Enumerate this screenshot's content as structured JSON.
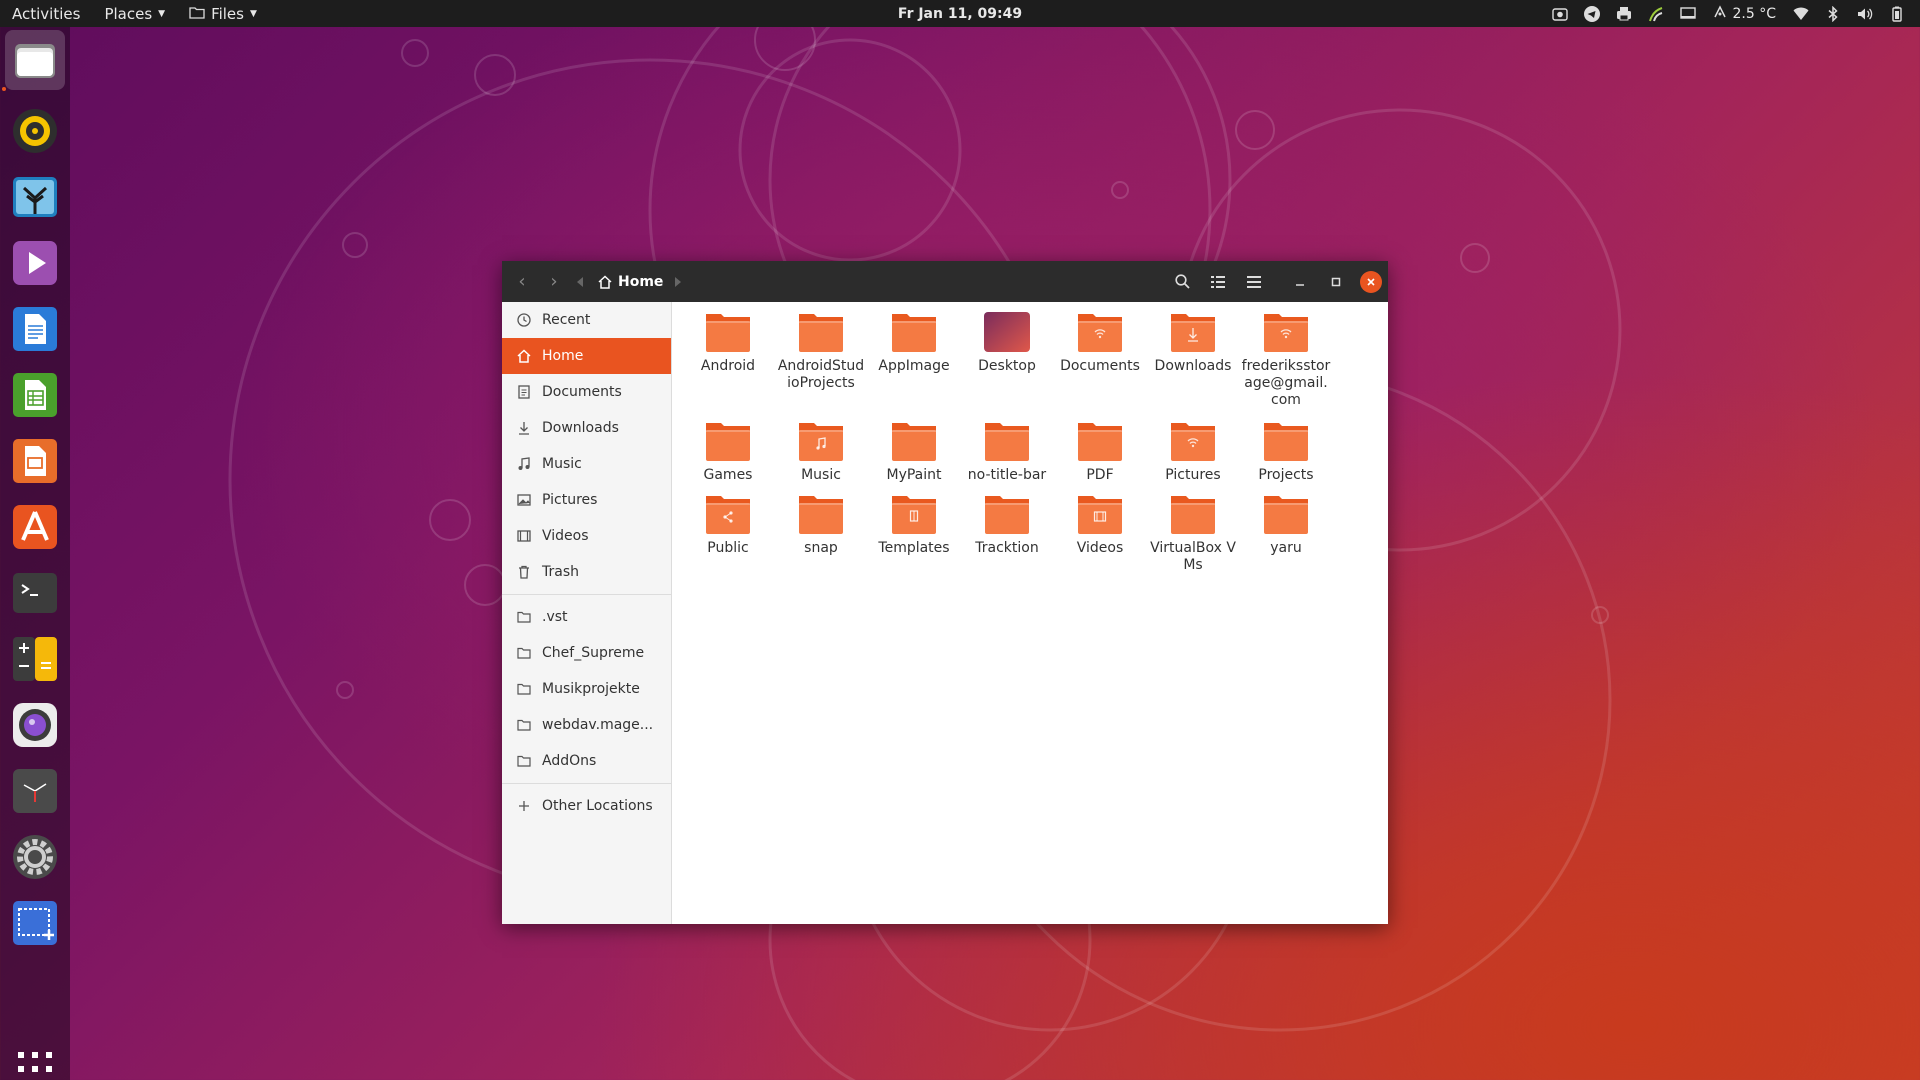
{
  "topbar": {
    "activities": "Activities",
    "places": "Places",
    "files_menu": "Files",
    "clock": "Fr Jan 11, 09:49",
    "temperature": "2.5 °C",
    "tray_icons": [
      "screenshot-icon",
      "telegram-icon",
      "printer-icon",
      "signal-icon",
      "display-icon",
      "weather-icon",
      "wifi-icon",
      "bluetooth-icon",
      "volume-icon",
      "battery-icon"
    ]
  },
  "dock": {
    "apps": [
      "files",
      "rhythmbox",
      "shotwell",
      "videos",
      "writer",
      "calc",
      "impress",
      "software",
      "terminal",
      "calculator",
      "screenshot-tool",
      "clock",
      "settings",
      "screen-selector"
    ],
    "show_apps": "show-applications-icon"
  },
  "window": {
    "path": "Home",
    "sidebar": {
      "places": [
        {
          "label": "Recent",
          "icon": "clock-icon"
        },
        {
          "label": "Home",
          "icon": "home-icon",
          "selected": true
        },
        {
          "label": "Documents",
          "icon": "document-icon"
        },
        {
          "label": "Downloads",
          "icon": "download-icon"
        },
        {
          "label": "Music",
          "icon": "music-icon"
        },
        {
          "label": "Pictures",
          "icon": "picture-icon"
        },
        {
          "label": "Videos",
          "icon": "video-icon"
        },
        {
          "label": "Trash",
          "icon": "trash-icon"
        }
      ],
      "bookmarks": [
        {
          "label": ".vst"
        },
        {
          "label": "Chef_Supreme"
        },
        {
          "label": "Musikprojekte"
        },
        {
          "label": "webdav.mage..."
        },
        {
          "label": "AddOns"
        }
      ],
      "other": "Other Locations"
    },
    "files": [
      {
        "name": "Android",
        "emblem": ""
      },
      {
        "name": "AndroidStudioProjects",
        "emblem": ""
      },
      {
        "name": "AppImage",
        "emblem": ""
      },
      {
        "name": "Desktop",
        "emblem": "desktop"
      },
      {
        "name": "Documents",
        "emblem": "share"
      },
      {
        "name": "Downloads",
        "emblem": "download"
      },
      {
        "name": "frederiksstorage@gmail.com",
        "emblem": "share"
      },
      {
        "name": "Games",
        "emblem": ""
      },
      {
        "name": "Music",
        "emblem": "music"
      },
      {
        "name": "MyPaint",
        "emblem": ""
      },
      {
        "name": "no-title-bar",
        "emblem": ""
      },
      {
        "name": "PDF",
        "emblem": ""
      },
      {
        "name": "Pictures",
        "emblem": "share"
      },
      {
        "name": "Projects",
        "emblem": ""
      },
      {
        "name": "Public",
        "emblem": "public"
      },
      {
        "name": "snap",
        "emblem": ""
      },
      {
        "name": "Templates",
        "emblem": "templates"
      },
      {
        "name": "Tracktion",
        "emblem": ""
      },
      {
        "name": "Videos",
        "emblem": "video"
      },
      {
        "name": "VirtualBox VMs",
        "emblem": ""
      },
      {
        "name": "yaru",
        "emblem": ""
      }
    ]
  },
  "colors": {
    "accent": "#e95420",
    "topbar": "#1d1d1d",
    "headerbar": "#2c2c2c",
    "folder_front": "#f47a43",
    "folder_back": "#e9591f"
  }
}
